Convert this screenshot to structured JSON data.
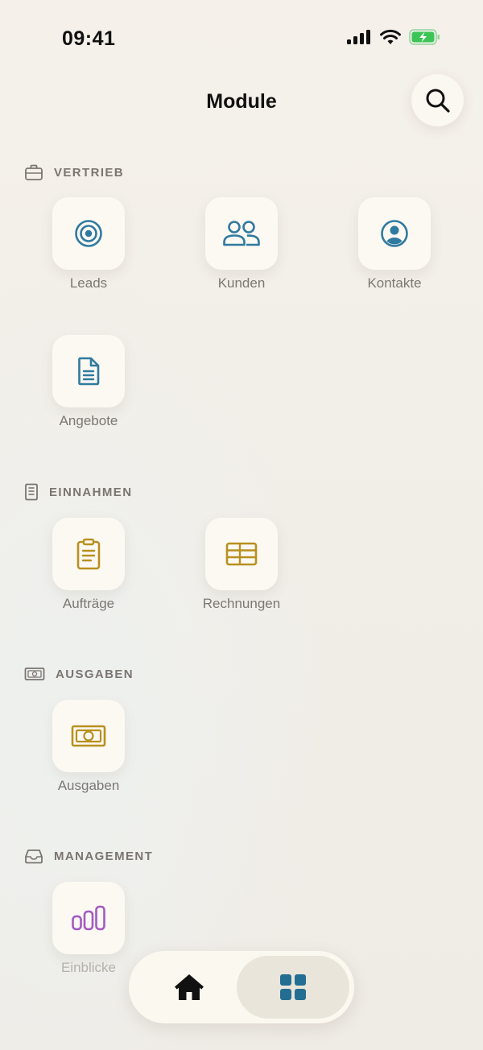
{
  "status_bar": {
    "time": "09:41"
  },
  "header": {
    "title": "Module"
  },
  "colors": {
    "blue": "#2f7aa0",
    "gold": "#b8901f",
    "purple": "#a25bc2",
    "nav_active": "#236e92",
    "section_gray": "#7a7570"
  },
  "sections": {
    "vertrieb": {
      "title": "VERTRIEB",
      "items": [
        {
          "label": "Leads",
          "icon": "target-icon"
        },
        {
          "label": "Kunden",
          "icon": "users-icon"
        },
        {
          "label": "Kontakte",
          "icon": "user-circle-icon"
        },
        {
          "label": "Angebote",
          "icon": "document-icon"
        }
      ]
    },
    "einnahmen": {
      "title": "EINNAHMEN",
      "items": [
        {
          "label": "Aufträge",
          "icon": "clipboard-icon"
        },
        {
          "label": "Rechnungen",
          "icon": "table-icon"
        }
      ]
    },
    "ausgaben": {
      "title": "AUSGABEN",
      "items": [
        {
          "label": "Ausgaben",
          "icon": "banknote-icon"
        }
      ]
    },
    "management": {
      "title": "MANAGEMENT",
      "items": [
        {
          "label": "Einblicke",
          "icon": "bar-chart-icon"
        }
      ]
    }
  },
  "bottom_nav": {
    "items": [
      {
        "icon": "home-icon",
        "active": false
      },
      {
        "icon": "grid-icon",
        "active": true
      }
    ]
  }
}
